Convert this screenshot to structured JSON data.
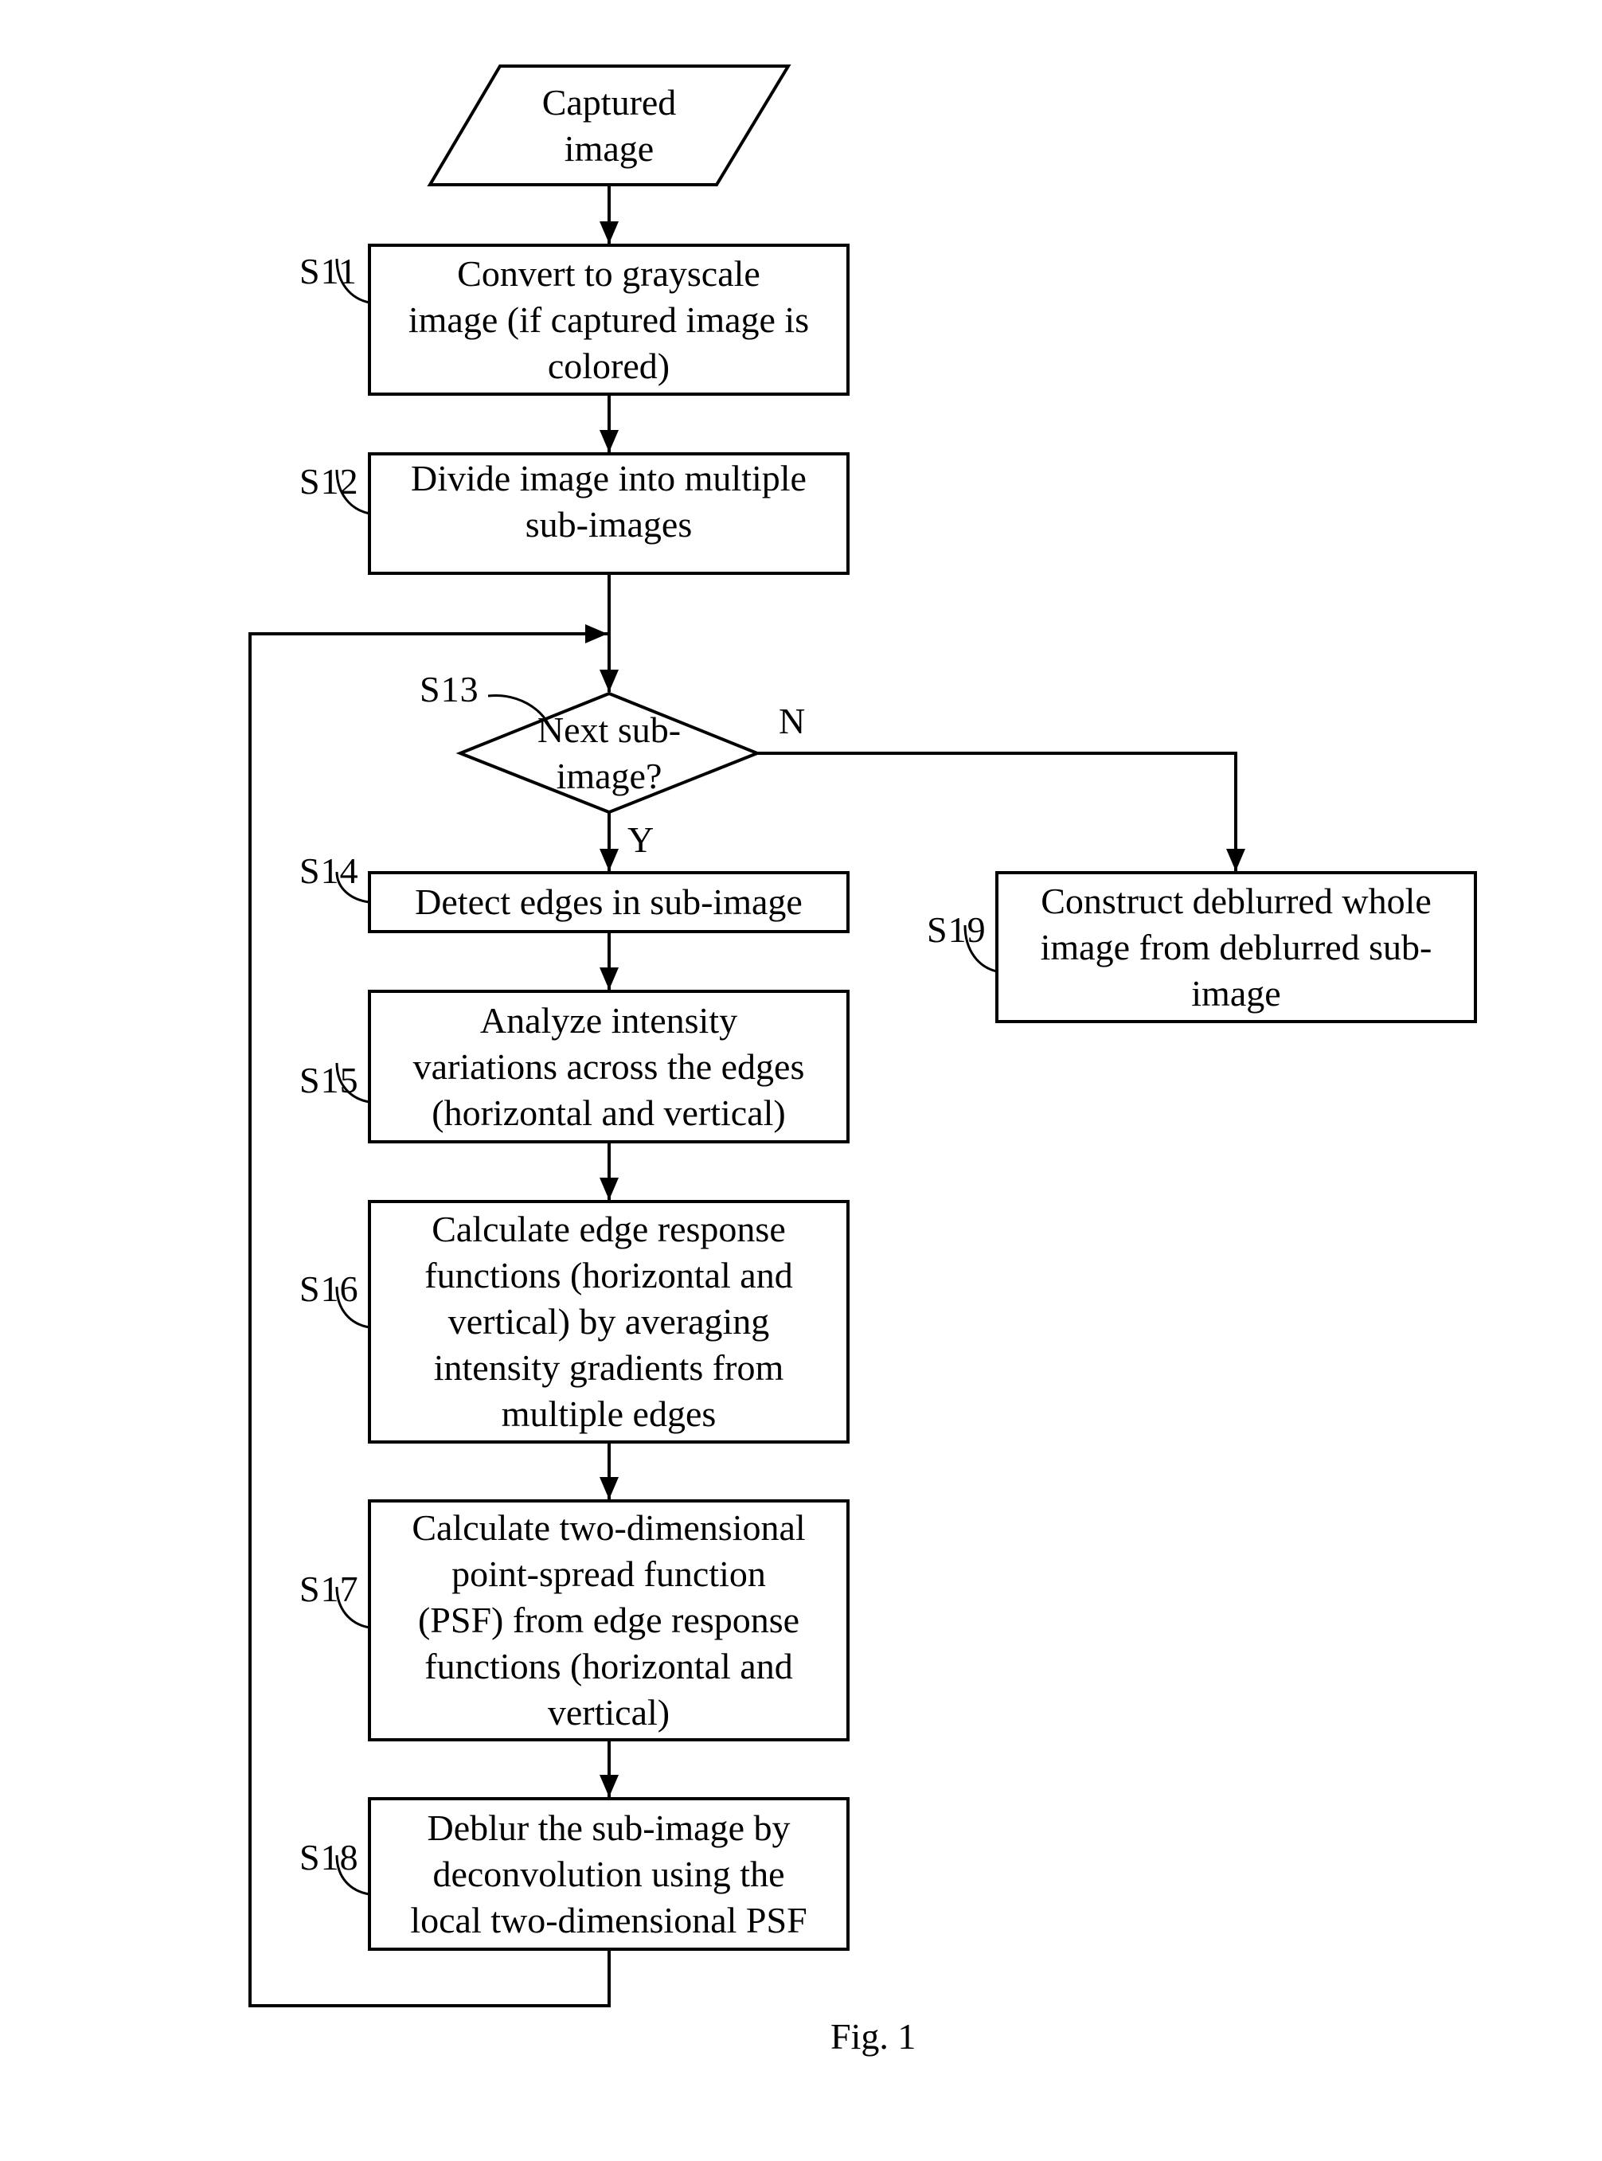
{
  "figure": {
    "caption": "Fig. 1",
    "line_color": "#000000",
    "background": "#ffffff"
  },
  "nodes": {
    "input": {
      "label": "Captured\nimage",
      "shape": "parallelogram"
    },
    "s11": {
      "step": "S11",
      "label": "Convert to grayscale\nimage (if captured image is\ncolored)",
      "shape": "process"
    },
    "s12": {
      "step": "S12",
      "label": "Divide image into multiple\nsub-images",
      "shape": "process"
    },
    "s13": {
      "step": "S13",
      "label": "Next sub-\nimage?",
      "shape": "decision"
    },
    "s14": {
      "step": "S14",
      "label": "Detect edges in sub-image",
      "shape": "process"
    },
    "s15": {
      "step": "S15",
      "label": "Analyze intensity\nvariations across the edges\n(horizontal and vertical)",
      "shape": "process"
    },
    "s16": {
      "step": "S16",
      "label": "Calculate edge response\nfunctions (horizontal and\nvertical) by averaging\nintensity gradients from\nmultiple edges",
      "shape": "process"
    },
    "s17": {
      "step": "S17",
      "label": "Calculate two-dimensional\npoint-spread function\n(PSF) from edge response\nfunctions (horizontal and\nvertical)",
      "shape": "process"
    },
    "s18": {
      "step": "S18",
      "label": "Deblur the sub-image by\ndeconvolution using the\nlocal two-dimensional PSF",
      "shape": "process"
    },
    "s19": {
      "step": "S19",
      "label": "Construct deblurred whole\nimage from deblurred sub-\nimage",
      "shape": "process"
    }
  },
  "edges": [
    {
      "from": "input",
      "to": "s11",
      "label": ""
    },
    {
      "from": "s11",
      "to": "s12",
      "label": ""
    },
    {
      "from": "s12",
      "to": "s13",
      "label": ""
    },
    {
      "from": "s13",
      "to": "s14",
      "label": "Y"
    },
    {
      "from": "s13",
      "to": "s19",
      "label": "N"
    },
    {
      "from": "s14",
      "to": "s15",
      "label": ""
    },
    {
      "from": "s15",
      "to": "s16",
      "label": ""
    },
    {
      "from": "s16",
      "to": "s17",
      "label": ""
    },
    {
      "from": "s17",
      "to": "s18",
      "label": ""
    },
    {
      "from": "s18",
      "to": "s13",
      "label": ""
    }
  ]
}
